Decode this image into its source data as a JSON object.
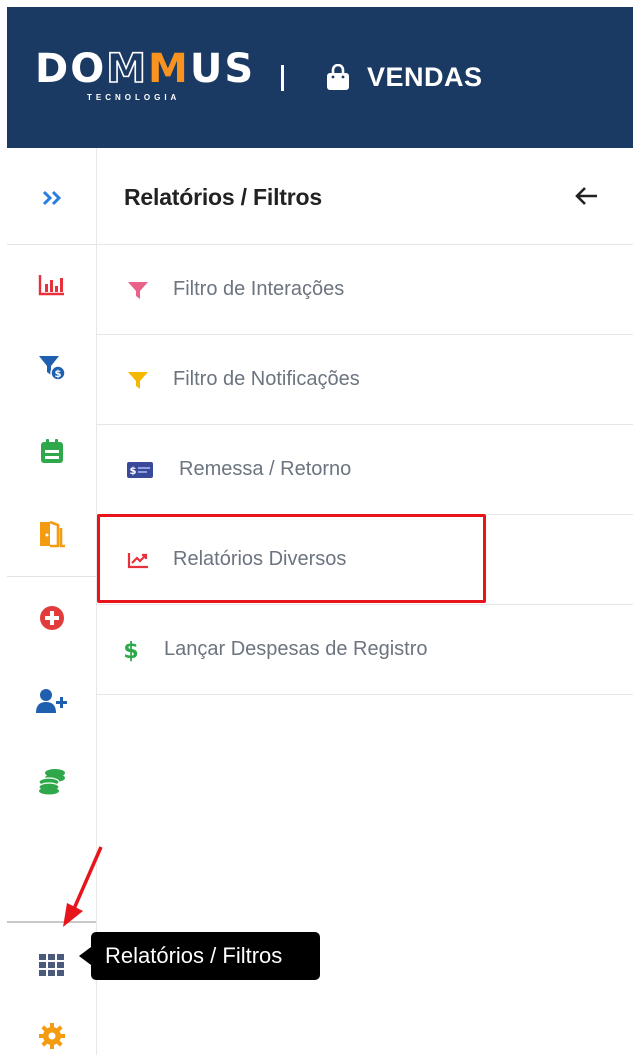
{
  "header": {
    "logo_text_left": "DO",
    "logo_text_hollow": "M",
    "logo_text_accent": "M",
    "logo_text_right": "US",
    "logo_subtitle": "TECNOLOGIA",
    "app_icon": "shopping-bag-icon",
    "app_label": "VENDAS",
    "background": "#1b3a63",
    "accent": "#f7931e"
  },
  "sidebar": {
    "items": [
      {
        "icon": "double-chevron-right-icon",
        "color": "#2a7de1"
      },
      {
        "icon": "bar-chart-icon",
        "color": "#e8303a"
      },
      {
        "icon": "filter-money-icon",
        "color": "#1f5fb0"
      },
      {
        "icon": "calendar-icon",
        "color": "#2ea84a"
      },
      {
        "icon": "door-exit-icon",
        "color": "#f39c12"
      },
      {
        "icon": "plus-circle-icon",
        "color": "#e23b3b"
      },
      {
        "icon": "user-plus-icon",
        "color": "#1f5fb0"
      },
      {
        "icon": "coins-stack-icon",
        "color": "#2ea84a"
      },
      {
        "icon": "grid-icon",
        "color": "#4a5a7a"
      },
      {
        "icon": "gear-icon",
        "color": "#f39c12"
      }
    ]
  },
  "panel": {
    "title": "Relatórios / Filtros",
    "back_icon": "arrow-left-icon",
    "items": [
      {
        "label": "Filtro de Interações",
        "icon": "filter-icon",
        "color": "#e8638a"
      },
      {
        "label": "Filtro de Notificações",
        "icon": "filter-icon",
        "color": "#f5b800"
      },
      {
        "label": "Remessa / Retorno",
        "icon": "money-card-icon",
        "color": "#3a4a9a"
      },
      {
        "label": "Relatórios Diversos",
        "icon": "line-chart-icon",
        "color": "#e8303a"
      },
      {
        "label": "Lançar Despesas de Registro",
        "icon": "dollar-icon",
        "color": "#2ea84a"
      }
    ]
  },
  "tooltip": {
    "text": "Relatórios / Filtros"
  },
  "annotation": {
    "highlight_color": "#e8141c"
  }
}
